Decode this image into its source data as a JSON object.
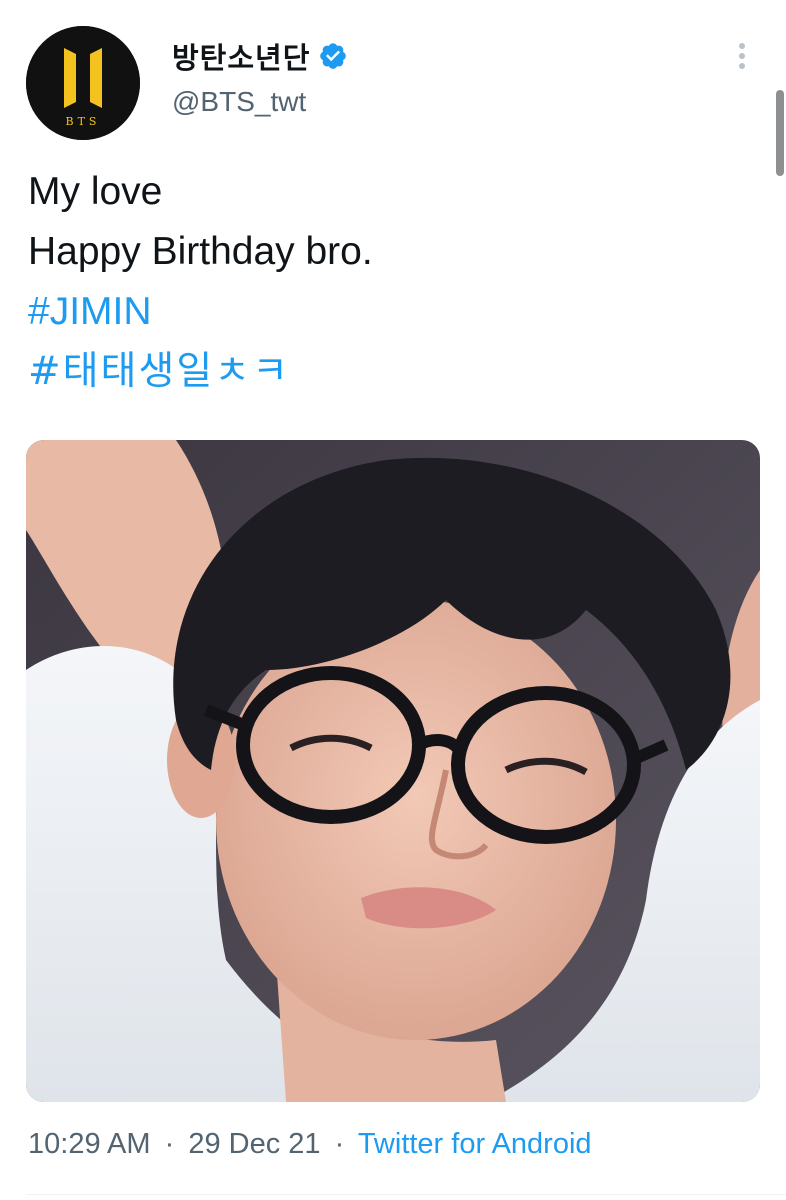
{
  "author": {
    "display_name": "방탄소년단",
    "handle": "@BTS_twt",
    "verified": true,
    "avatar_logo_text": "BTS"
  },
  "tweet": {
    "lines": [
      "My love",
      "Happy Birthday bro."
    ],
    "hashtags": [
      "#JIMIN",
      "#태태생일ㅊㅋ"
    ]
  },
  "media": {
    "type": "photo",
    "description": "selfie photo"
  },
  "meta": {
    "time": "10:29 AM",
    "date": "29 Dec 21",
    "separator": "·",
    "source": "Twitter for Android"
  },
  "icons": {
    "more": "more-vertical-icon",
    "verified": "verified-badge-icon"
  },
  "colors": {
    "link": "#1d9bf0",
    "text": "#0f1419",
    "secondary": "#536471",
    "logo_yellow": "#f3c21f"
  }
}
